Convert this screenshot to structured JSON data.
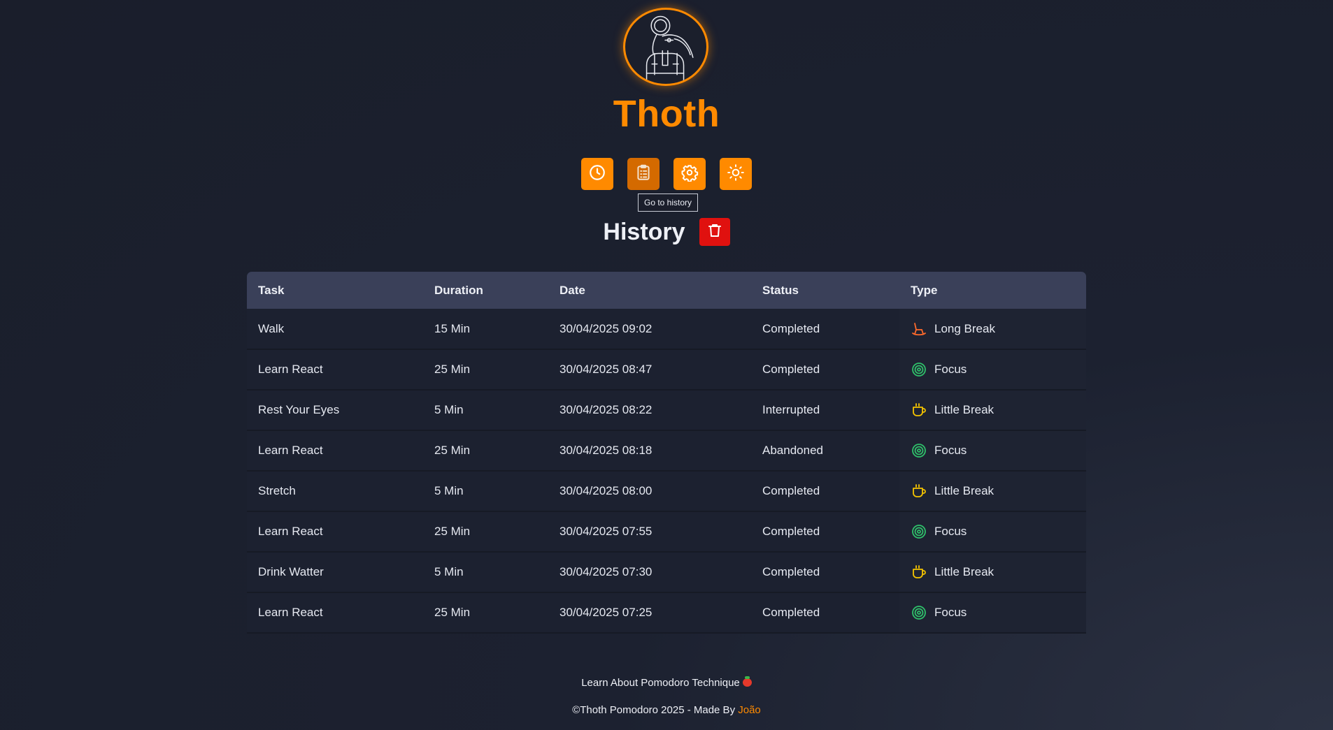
{
  "app": {
    "title": "Thoth"
  },
  "colors": {
    "accent": "#ff8a00",
    "danger": "#e0110f",
    "focus": "#2fc06a",
    "little_break": "#f5c400",
    "long_break": "#ff6a2b"
  },
  "nav": {
    "items": [
      {
        "icon": "clock-icon",
        "name": "home"
      },
      {
        "icon": "clipboard-icon",
        "name": "history"
      },
      {
        "icon": "gear-icon",
        "name": "settings"
      },
      {
        "icon": "sun-icon",
        "name": "theme"
      }
    ],
    "tooltip": "Go to history"
  },
  "history": {
    "title": "History"
  },
  "table": {
    "headers": [
      "Task",
      "Duration",
      "Date",
      "Status",
      "Type"
    ],
    "rows": [
      {
        "task": "Walk",
        "duration": "15 Min",
        "date": "30/04/2025 09:02",
        "status": "Completed",
        "type": "Long Break",
        "icon": "rocking-chair-icon"
      },
      {
        "task": "Learn React",
        "duration": "25 Min",
        "date": "30/04/2025 08:47",
        "status": "Completed",
        "type": "Focus",
        "icon": "target-icon"
      },
      {
        "task": "Rest Your Eyes",
        "duration": "5 Min",
        "date": "30/04/2025 08:22",
        "status": "Interrupted",
        "type": "Little Break",
        "icon": "coffee-icon"
      },
      {
        "task": "Learn React",
        "duration": "25 Min",
        "date": "30/04/2025 08:18",
        "status": "Abandoned",
        "type": "Focus",
        "icon": "target-icon"
      },
      {
        "task": "Stretch",
        "duration": "5 Min",
        "date": "30/04/2025 08:00",
        "status": "Completed",
        "type": "Little Break",
        "icon": "coffee-icon"
      },
      {
        "task": "Learn React",
        "duration": "25 Min",
        "date": "30/04/2025 07:55",
        "status": "Completed",
        "type": "Focus",
        "icon": "target-icon"
      },
      {
        "task": "Drink Watter",
        "duration": "5 Min",
        "date": "30/04/2025 07:30",
        "status": "Completed",
        "type": "Little Break",
        "icon": "coffee-icon"
      },
      {
        "task": "Learn React",
        "duration": "25 Min",
        "date": "30/04/2025 07:25",
        "status": "Completed",
        "type": "Focus",
        "icon": "target-icon"
      }
    ]
  },
  "footer": {
    "link": "Learn About Pomodoro Technique",
    "credit": "©Thoth Pomodoro 2025 - Made By",
    "author": "João"
  }
}
